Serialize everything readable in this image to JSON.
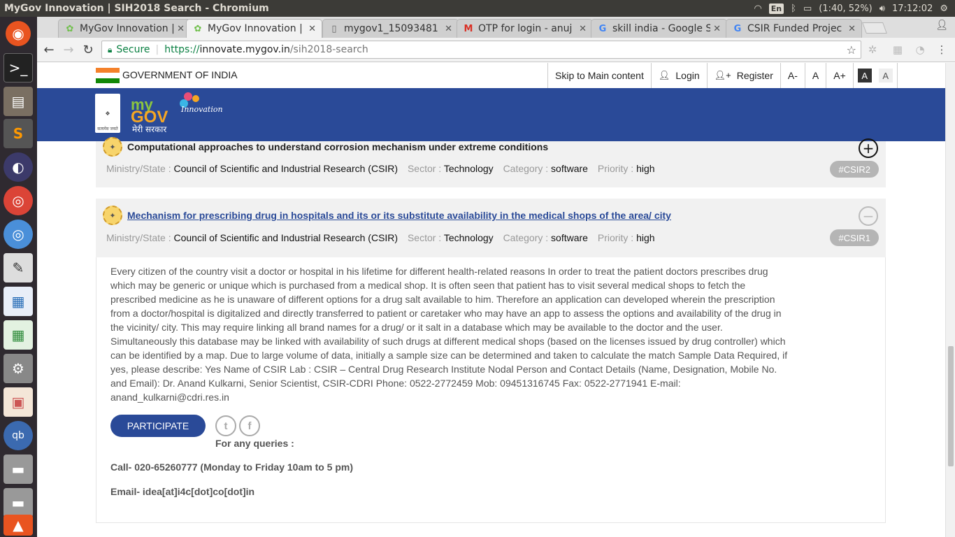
{
  "os": {
    "window_title": "MyGov Innovation | SIH2018 Search - Chromium",
    "lang": "En",
    "battery": "(1:40, 52%)",
    "clock": "17:12:02"
  },
  "tabs": [
    {
      "label": "MyGov Innovation |",
      "favicon": "mygov-icon"
    },
    {
      "label": "MyGov Innovation |",
      "favicon": "mygov-icon"
    },
    {
      "label": "mygov1_15093481",
      "favicon": "document-icon"
    },
    {
      "label": "OTP for login - anuj",
      "favicon": "gmail-icon"
    },
    {
      "label": "skill india - Google S",
      "favicon": "google-icon"
    },
    {
      "label": "CSIR Funded Projec",
      "favicon": "google-icon"
    }
  ],
  "omnibox": {
    "secure": "Secure",
    "scheme": "https://",
    "host": "innovate.mygov.in",
    "path": "/sih2018-search"
  },
  "gov_bar": {
    "label": "GOVERNMENT OF INDIA",
    "skip": "Skip to Main content",
    "login": "Login",
    "register": "Register",
    "font_minus": "A-",
    "font_normal": "A",
    "font_plus": "A+",
    "contrast_dark": "A",
    "contrast_light": "A"
  },
  "banner": {
    "emblem_text": "सत्यमेव जयते",
    "logo_my": "my",
    "logo_gov": "GOV",
    "logo_innovation": "Innovation",
    "logo_sarkar": "मेरी सरकार"
  },
  "meta_labels": {
    "ministry": "Ministry/State :",
    "sector": "Sector :",
    "category": "Category :",
    "priority": "Priority :"
  },
  "problems": [
    {
      "title": "Computational approaches to understand corrosion mechanism under extreme conditions",
      "ministry": "Council of Scientific and Industrial Research (CSIR)",
      "sector": "Technology",
      "category": "software",
      "priority": "high",
      "tag": "#CSIR2",
      "toggle": "+"
    },
    {
      "title": "Mechanism for prescribing drug in hospitals and its or its substitute availability in the medical shops of the area/ city",
      "ministry": "Council of Scientific and Industrial Research (CSIR)",
      "sector": "Technology",
      "category": "software",
      "priority": "high",
      "tag": "#CSIR1",
      "toggle": "−"
    }
  ],
  "detail": {
    "description": "Every citizen of the country visit a doctor or hospital in his lifetime for different health-related reasons In order to treat the patient doctors prescribes drug which may be generic or unique which is purchased from a medical shop. It is often seen that patient has to visit several medical shops to fetch the prescribed medicine as he is unaware of different options for a drug salt available to him. Therefore an application can developed wherein the prescription from a doctor/hospital is digitalized and directly transferred to patient or caretaker who may have an app to assess the options and availability of the drug in the vicinity/ city. This may require linking all brand names for a drug/ or it salt in a database which may be available to the doctor and the user. Simultaneously this database may be linked with availability of such drugs at different medical shops (based on the licenses issued by drug controller) which can be identified by a map. Due to large volume of data, initially a sample size can be determined and taken to calculate the match Sample Data Required, if yes, please describe: Yes Name of CSIR Lab : CSIR – Central Drug Research Institute Nodal Person and Contact Details (Name, Designation, Mobile No. and Email): Dr. Anand Kulkarni, Senior Scientist, CSIR-CDRI Phone: 0522-2772459 Mob: 09451316745 Fax: 0522-2771941 E-mail: anand_kulkarni@cdri.res.in",
    "participate": "PARTICIPATE",
    "twitter": "t",
    "facebook": "f",
    "queries": "For any queries :",
    "call": "Call- 020-65260777 (Monday to Friday 10am to 5 pm)",
    "email": "Email- idea[at]i4c[dot]co[dot]in"
  }
}
